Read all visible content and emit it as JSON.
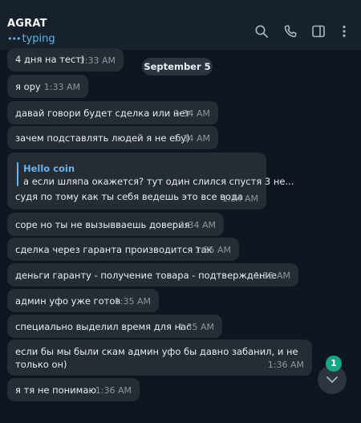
{
  "header": {
    "title": "AGRAT",
    "status": "typing",
    "icons": [
      "search-icon",
      "phone-icon",
      "sidebar-icon",
      "more-icon"
    ]
  },
  "date_separator": "September 5",
  "messages": [
    {
      "text": "4 дня на тест)",
      "time": "1:33 AM"
    },
    {
      "text": "я ору",
      "time": "1:33 AM"
    },
    {
      "text": "давай говори будет сделка или нет",
      "time": "1:34 AM"
    },
    {
      "text": "зачем подставлять людей я не ебу)",
      "time": "1:34 AM"
    },
    {
      "reply_name": "Hello coin",
      "reply_text": "а если шляпа окажется? тут один слился спустя 3 не...",
      "text": "судя по тому как ты себя ведешь это все вода",
      "time": "1:34 AM"
    },
    {
      "text": "соре но ты не вызывваешь доверия",
      "time": "1:34 AM"
    },
    {
      "text": "сделка через гаранта производится так",
      "time": "1:35 AM"
    },
    {
      "text": "деньги гаранту - получение товара - подтверждение",
      "time": "1:35 AM"
    },
    {
      "text": "админ уфо уже готов",
      "time": "1:35 AM"
    },
    {
      "text": "специально выделил время для нас",
      "time": "1:35 AM"
    },
    {
      "text_line1": "если бы мы были скам админ уфо бы давно забанил, и не",
      "text_line2": "только он)",
      "time": "1:36 AM"
    },
    {
      "text": "я тя не понимаю",
      "time": "1:36 AM"
    }
  ],
  "scroll_button": {
    "icon": "chevron-down-icon",
    "unread_count": "1"
  },
  "colors": {
    "background": "#0e1621",
    "header": "#17212b",
    "bubble": "#262c34",
    "accent": "#6ab3f3",
    "badge": "#17a585"
  }
}
